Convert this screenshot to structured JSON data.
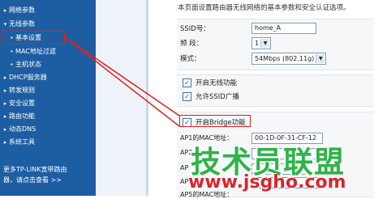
{
  "sidebar": {
    "items": [
      {
        "arrow": "▸",
        "label": "网络参数"
      },
      {
        "arrow": "▾",
        "label": "无线参数"
      },
      {
        "arrow": "•",
        "label": "基本设置"
      },
      {
        "arrow": "•",
        "label": "MAC地址过滤"
      },
      {
        "arrow": "•",
        "label": "主机状态"
      },
      {
        "arrow": "▸",
        "label": "DHCP服务器"
      },
      {
        "arrow": "▸",
        "label": "转发规则"
      },
      {
        "arrow": "▸",
        "label": "安全设置"
      },
      {
        "arrow": "▸",
        "label": "路由功能"
      },
      {
        "arrow": "▸",
        "label": "动态DNS"
      },
      {
        "arrow": "▸",
        "label": "系统工具"
      }
    ],
    "promo_line1": "更多TP-LINK宽带路由",
    "promo_line2": "器，请点击查看 >>"
  },
  "main": {
    "intro": "本页面设置路由器无线网络的基本参数和安全认证选项。",
    "ssid_label": "SSID号：",
    "ssid_value": "home_A",
    "channel_label": "频  段：",
    "channel_value": "1",
    "mode_label": "模式：",
    "mode_value": "54Mbps (802.11g)",
    "enable_wireless_label": "开启无线功能",
    "enable_ssid_broadcast_label": "允许SSID广播",
    "enable_bridge_label": "开启Bridge功能",
    "ap1_label": "AP1的MAC地址：",
    "ap1_value": "00-1D-0F-31-CF-12",
    "ap2_label": "AP2",
    "ap3_label": "AP",
    "ap4_label": "AP",
    "ap5_label": "AP5的MAC地址："
  },
  "watermark": {
    "line1": "技术员联盟",
    "line2": "www.jsgho.com"
  },
  "colors": {
    "sidebar_bg": "#1d5ea3",
    "highlight": "#e02020",
    "watermark_green": "#2fb34a",
    "watermark_red": "#d8262e"
  }
}
